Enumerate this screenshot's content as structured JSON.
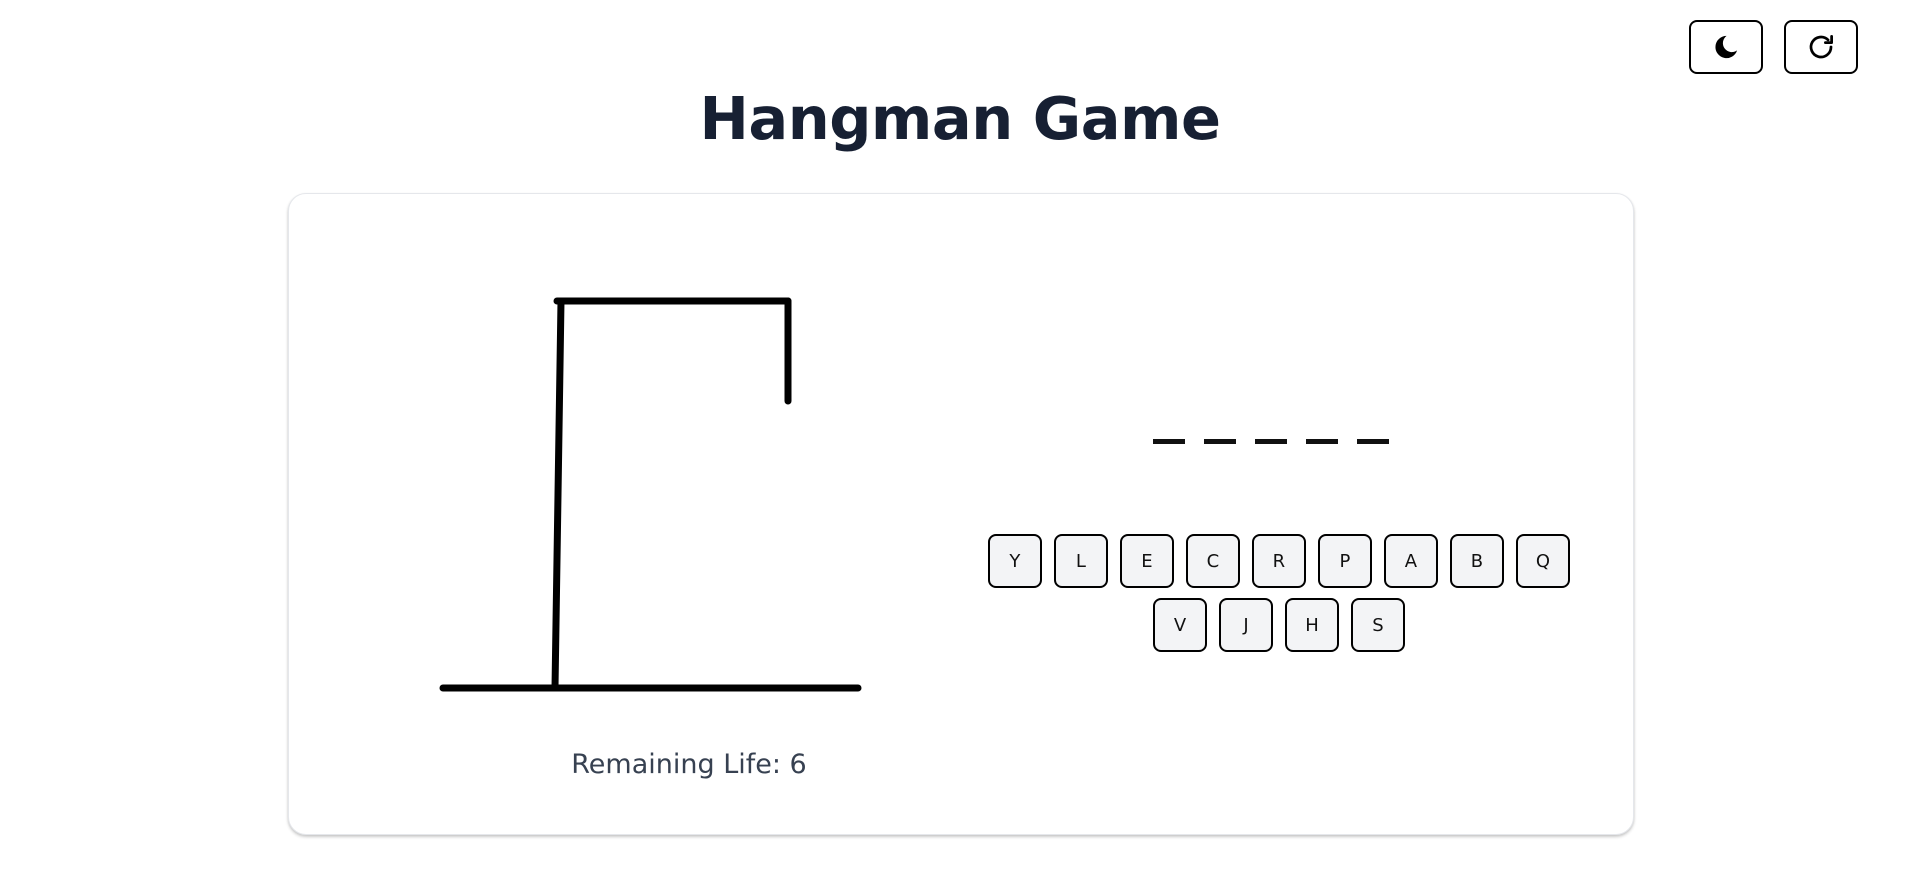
{
  "header": {
    "title": "Hangman Game",
    "theme_icon": "moon-icon",
    "restart_icon": "refresh-icon"
  },
  "game": {
    "remaining_life_text": "Remaining Life: 6",
    "remaining_life": 6,
    "word_length": 5,
    "revealed": [
      "",
      "",
      "",
      "",
      ""
    ],
    "letters": [
      "Y",
      "L",
      "E",
      "C",
      "R",
      "P",
      "A",
      "B",
      "Q",
      "V",
      "J",
      "H",
      "S"
    ]
  },
  "colors": {
    "title": "#172033",
    "key_bg": "#f3f4f6",
    "life_text": "#374151",
    "stroke": "#000000"
  }
}
